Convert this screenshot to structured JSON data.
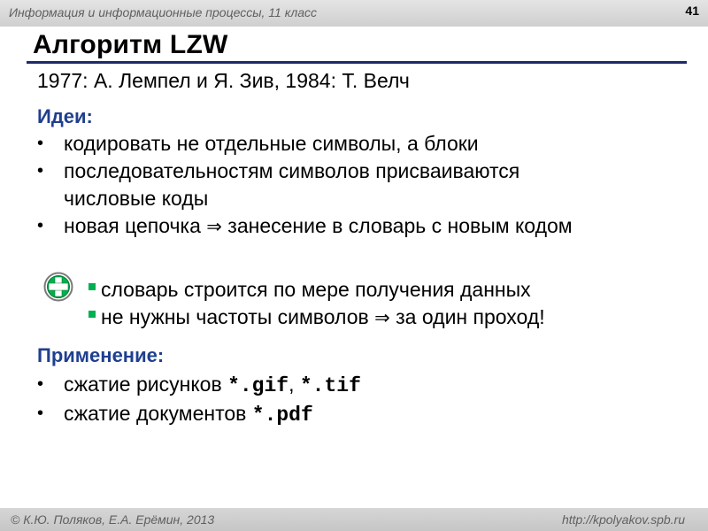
{
  "header": {
    "course": "Информация и информационные процессы, 11 класс",
    "slide_number": "41"
  },
  "slide": {
    "title": "Алгоритм LZW",
    "subtitle": "1977: А. Лемпел и Я. Зив, 1984: Т. Велч",
    "ideas_heading": "Идеи:",
    "ideas": [
      "кодировать не отдельные символы, а блоки",
      "последовательностям символов присваиваются",
      "числовые коды",
      "новая цепочка",
      "занесение в словарь с новым кодом"
    ],
    "advantages": {
      "icon": "plus-icon",
      "items": [
        "словарь строится по мере получения данных",
        "не нужны частоты символов",
        "за один проход!"
      ]
    },
    "usage_heading": "Применение:",
    "usage": [
      {
        "text": "сжатие рисунков",
        "ext1": "*.gif",
        "sep": ",",
        "ext2": "*.tif"
      },
      {
        "text": "сжатие документов",
        "ext1": "*.pdf"
      }
    ],
    "implies_symbol": "⇒"
  },
  "footer": {
    "authors": "© К.Ю. Поляков, Е.А. Ерёмин, 2013",
    "url": "http://kpolyakov.spb.ru"
  },
  "colors": {
    "accent": "#1f3f8f",
    "rule": "#1f2a6b",
    "plus_green": "#00b050"
  }
}
